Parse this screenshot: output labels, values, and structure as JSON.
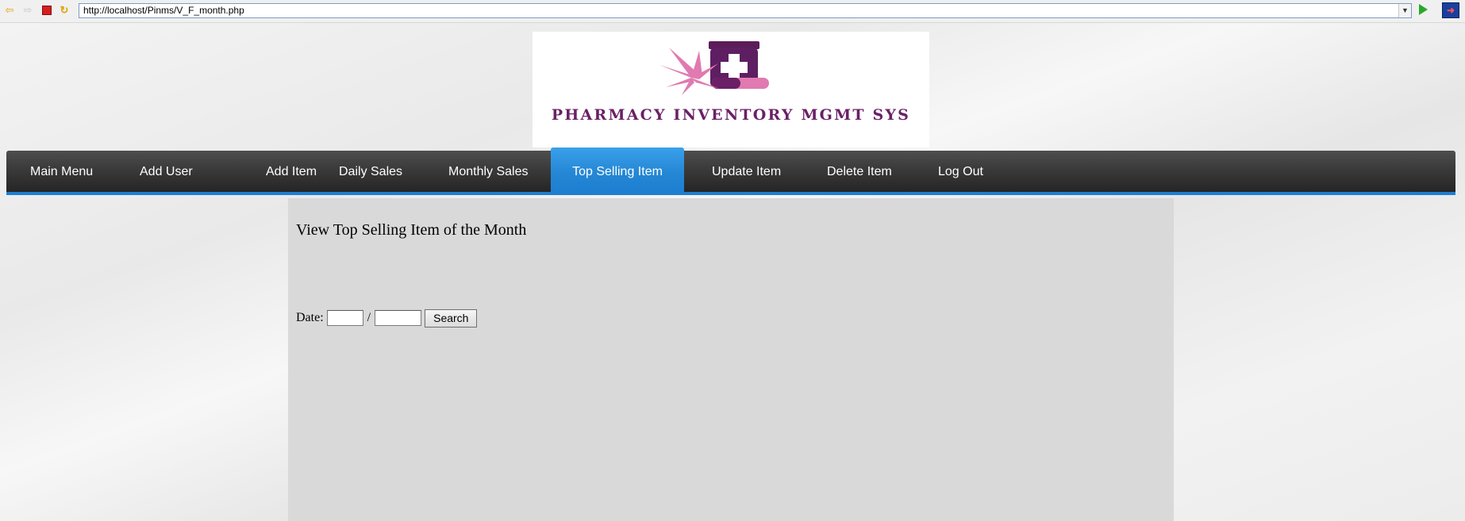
{
  "browser": {
    "url": "http://localhost/Pinms/V_F_month.php",
    "icons": {
      "back": "back-arrow-icon",
      "forward": "forward-arrow-icon",
      "stop": "stop-icon",
      "refresh": "refresh-icon",
      "go": "go-arrow-icon",
      "exit": "exit-icon"
    }
  },
  "logo": {
    "text": "PHARMACY INVENTORY MGMT SYS",
    "colors": {
      "primary": "#6b1f66",
      "accent": "#e07ab0"
    }
  },
  "nav": {
    "items": [
      {
        "label": "Main Menu"
      },
      {
        "label": "Add User"
      },
      {
        "label": "Add Item"
      },
      {
        "label": "Daily Sales"
      },
      {
        "label": "Monthly Sales"
      },
      {
        "label": "Top Selling Item",
        "active": true
      },
      {
        "label": "Update Item"
      },
      {
        "label": "Delete Item"
      },
      {
        "label": "Log Out"
      }
    ],
    "colors": {
      "bar": "#333333",
      "active": "#1e7fd1"
    }
  },
  "main": {
    "title": "View Top Selling Item of the Month",
    "date_label": "Date:",
    "separator": "/",
    "month_value": "",
    "year_value": "",
    "search_label": "Search"
  }
}
